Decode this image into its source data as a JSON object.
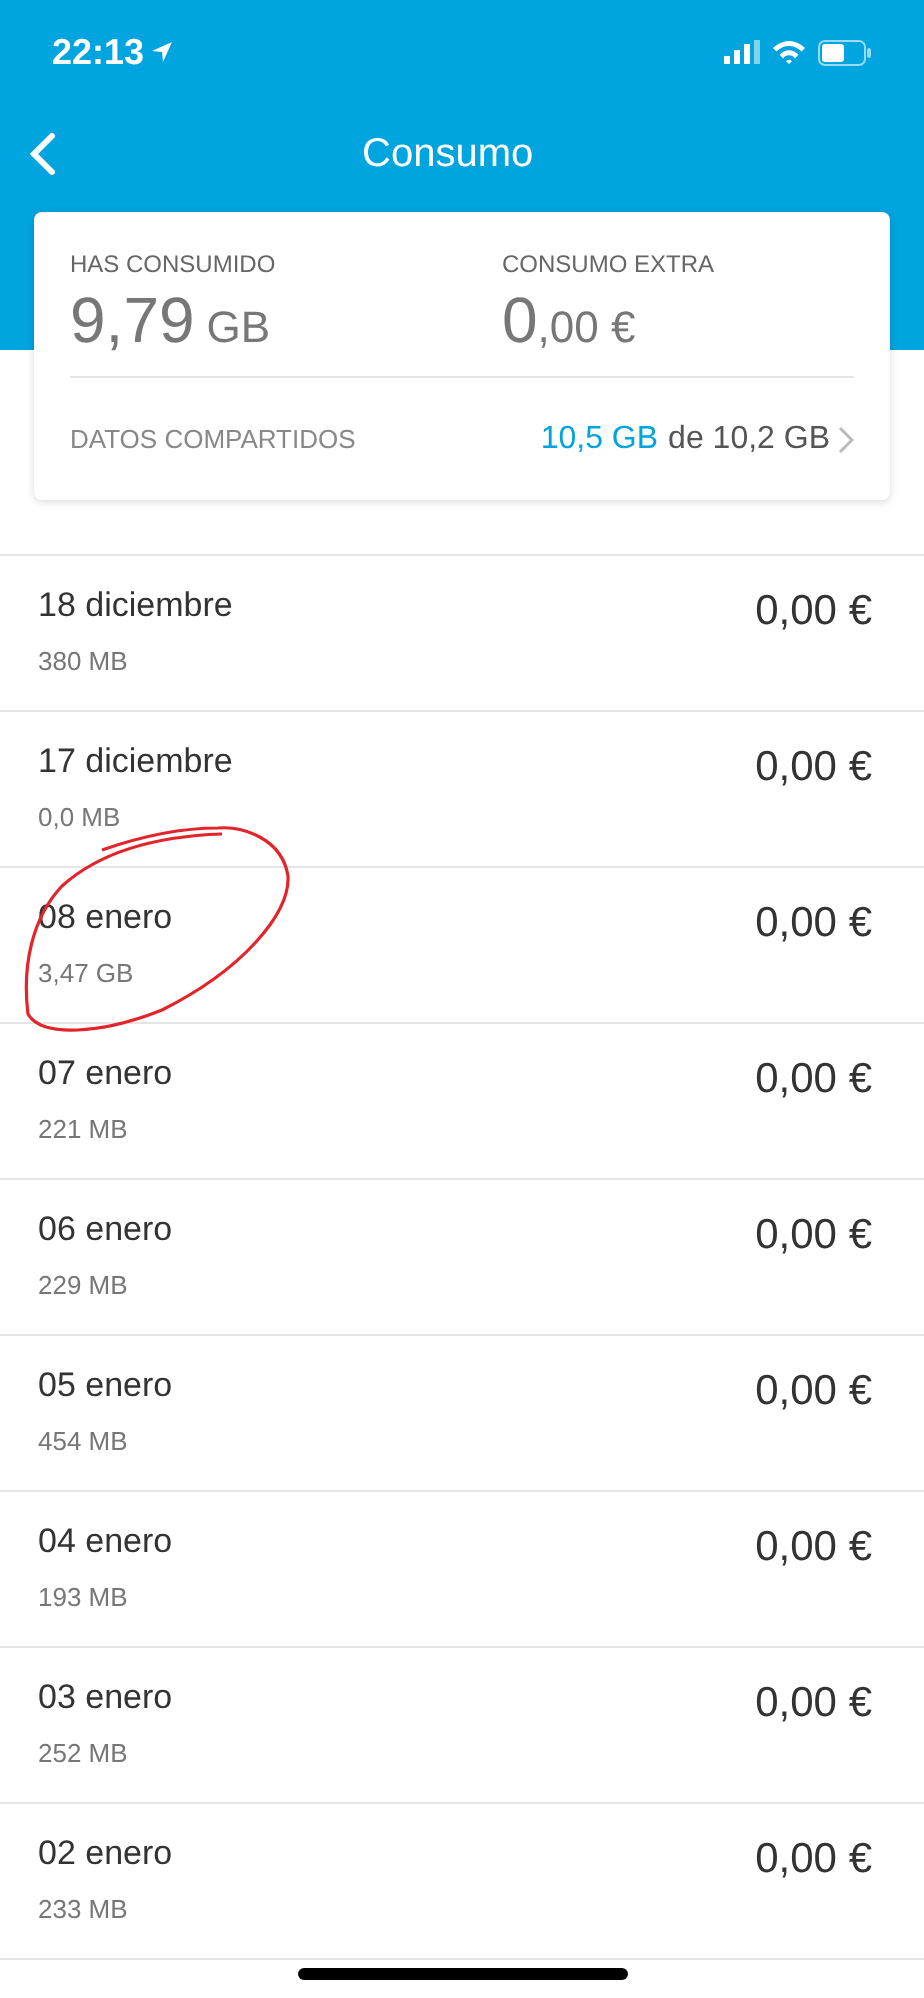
{
  "status_bar": {
    "time": "22:13"
  },
  "nav": {
    "title": "Consumo"
  },
  "summary": {
    "used_label": "HAS CONSUMIDO",
    "used_value": "9,79",
    "used_unit": "GB",
    "extra_label": "CONSUMO EXTRA",
    "extra_value": "0",
    "extra_decimals": ",00 €",
    "shared_label": "DATOS COMPARTIDOS",
    "shared_used": "10,5 GB",
    "shared_rest": "de 10,2 GB"
  },
  "days": [
    {
      "date": "18 diciembre",
      "data": "380 MB",
      "cost": "0,00 €"
    },
    {
      "date": "17 diciembre",
      "data": "0,0 MB",
      "cost": "0,00 €"
    },
    {
      "date": "08 enero",
      "data": "3,47 GB",
      "cost": "0,00 €"
    },
    {
      "date": "07 enero",
      "data": "221 MB",
      "cost": "0,00 €"
    },
    {
      "date": "06 enero",
      "data": "229 MB",
      "cost": "0,00 €"
    },
    {
      "date": "05 enero",
      "data": "454 MB",
      "cost": "0,00 €"
    },
    {
      "date": "04 enero",
      "data": "193 MB",
      "cost": "0,00 €"
    },
    {
      "date": "03 enero",
      "data": "252 MB",
      "cost": "0,00 €"
    },
    {
      "date": "02 enero",
      "data": "233 MB",
      "cost": "0,00 €"
    }
  ]
}
